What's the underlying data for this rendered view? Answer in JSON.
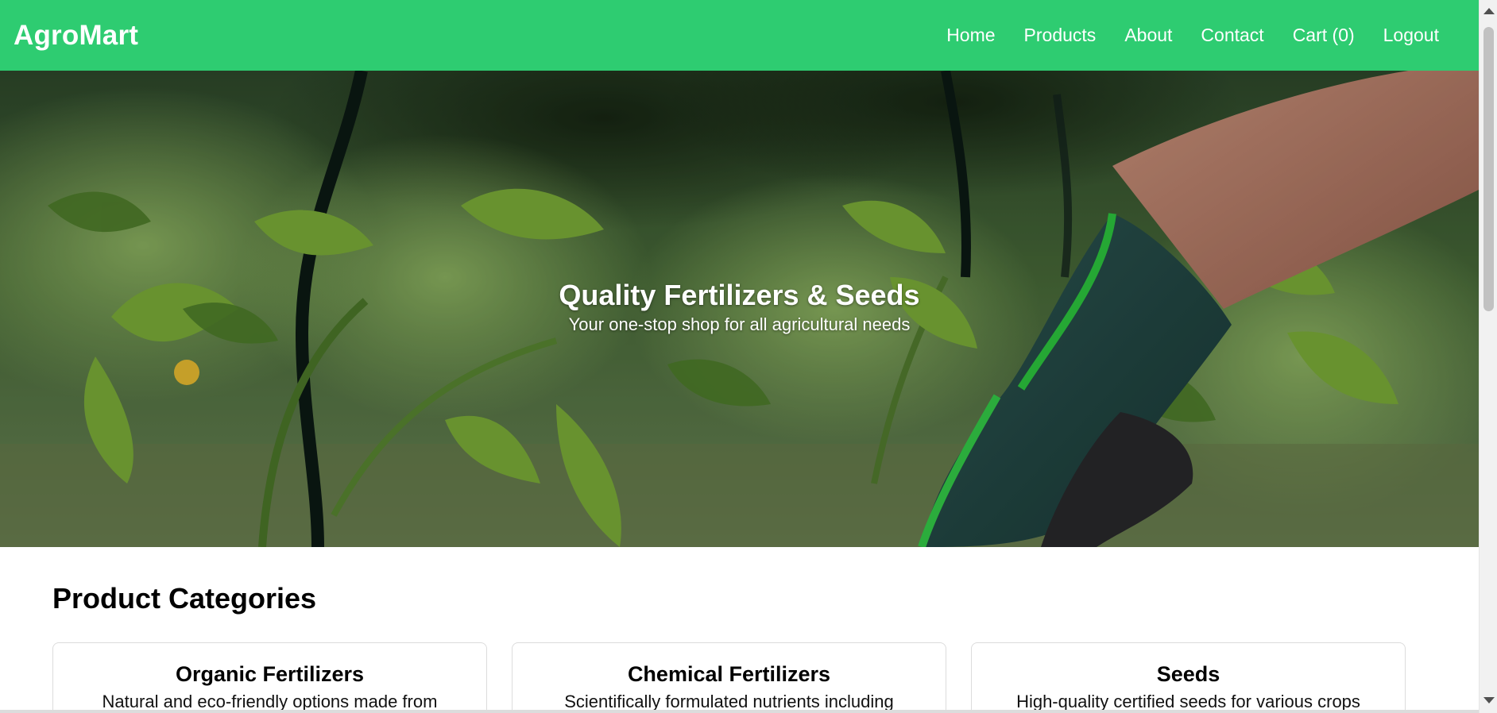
{
  "brand": {
    "name": "AgroMart"
  },
  "nav": {
    "items": [
      {
        "label": "Home"
      },
      {
        "label": "Products"
      },
      {
        "label": "About"
      },
      {
        "label": "Contact"
      },
      {
        "label": "Cart (0)"
      },
      {
        "label": "Logout"
      }
    ]
  },
  "hero": {
    "title": "Quality Fertilizers & Seeds",
    "subtitle": "Your one-stop shop for all agricultural needs"
  },
  "categories": {
    "title": "Product Categories",
    "items": [
      {
        "title": "Organic Fertilizers",
        "description": "Natural and eco-friendly options made from"
      },
      {
        "title": "Chemical Fertilizers",
        "description": "Scientifically formulated nutrients including"
      },
      {
        "title": "Seeds",
        "description": "High-quality certified seeds for various crops"
      }
    ]
  },
  "colors": {
    "primary": "#2ecc71",
    "text": "#111111",
    "card_border": "#dcdcdc"
  },
  "icons": {
    "scroll_up": "arrow-up-icon",
    "scroll_down": "arrow-down-icon"
  }
}
